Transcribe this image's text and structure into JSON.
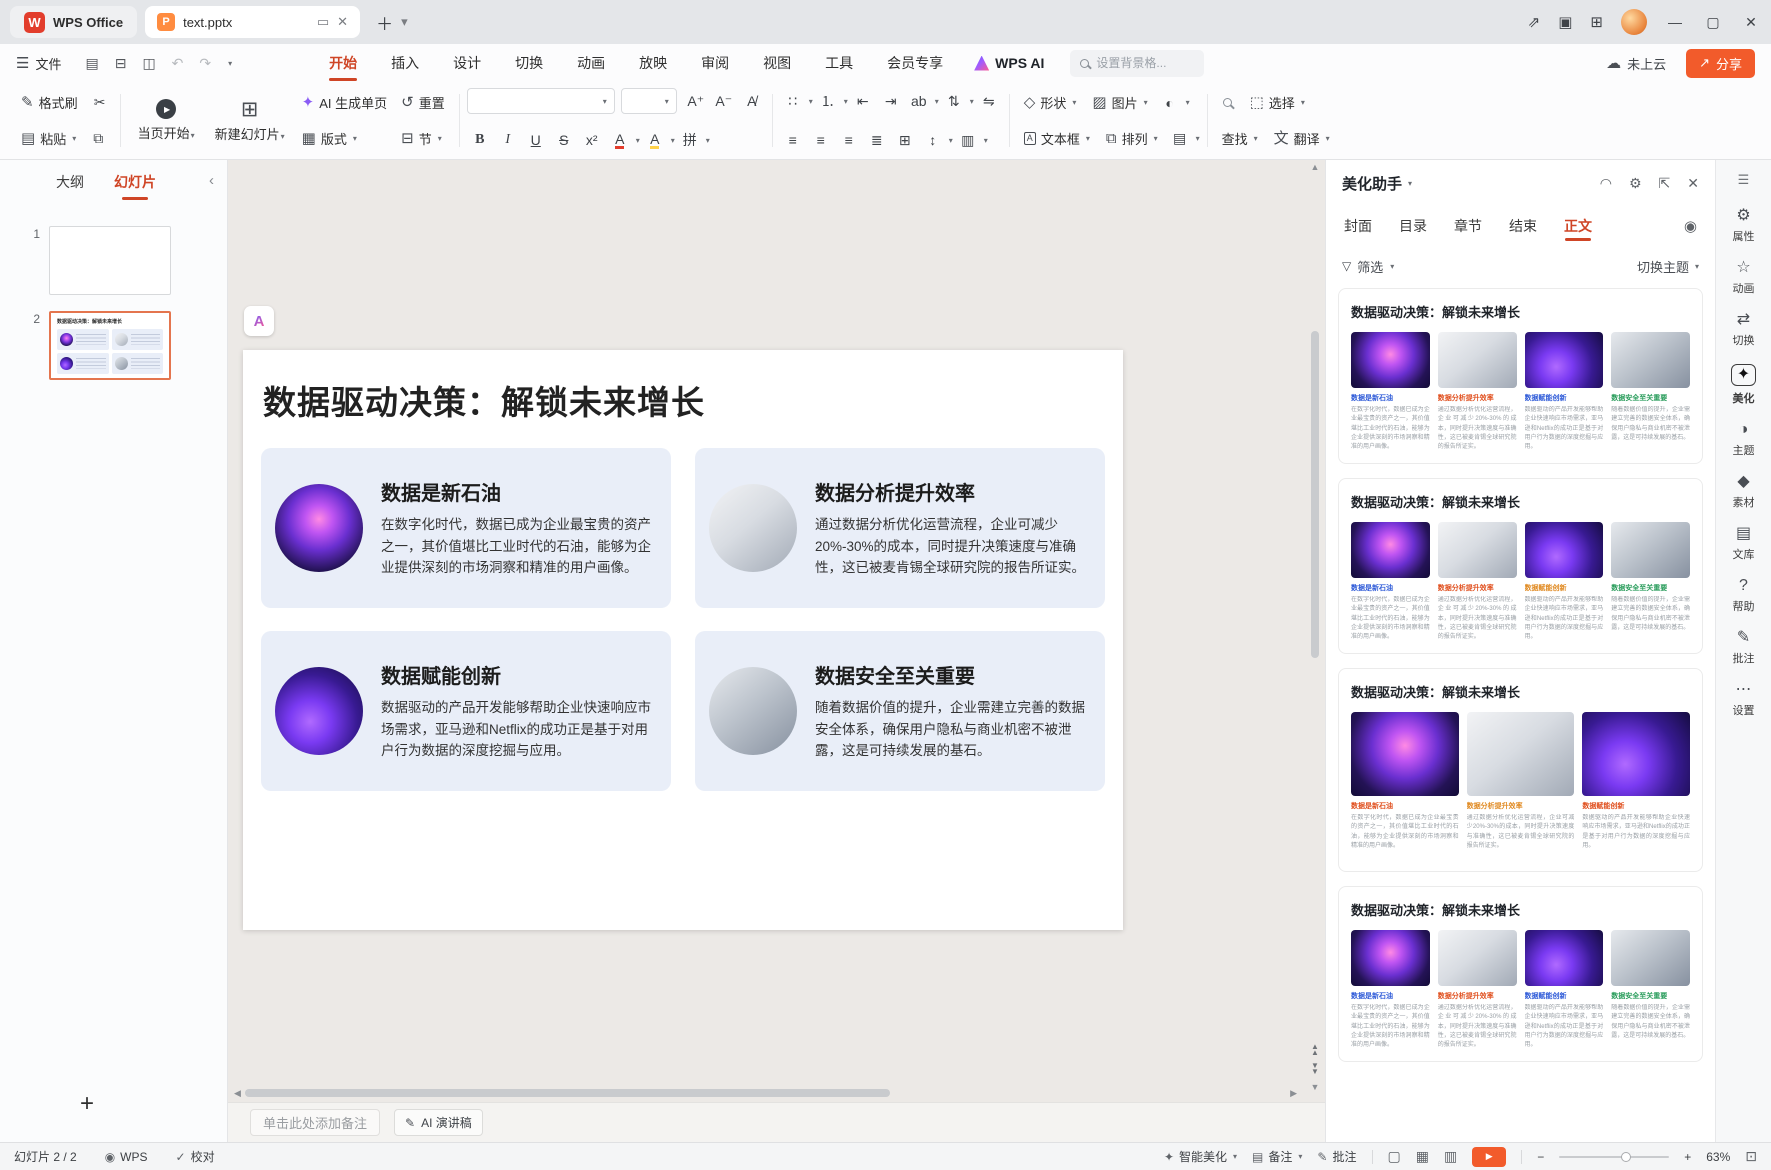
{
  "titlebar": {
    "home_tab": "WPS Office",
    "doc_tab": "text.pptx"
  },
  "menubar": {
    "file": "文件",
    "tabs": [
      "开始",
      "插入",
      "设计",
      "切换",
      "动画",
      "放映",
      "审阅",
      "视图",
      "工具",
      "会员专享"
    ],
    "active_tab": "开始",
    "wps_ai": "WPS AI",
    "search_placeholder": "设置背景格...",
    "cloud_status": "未上云",
    "share": "分享"
  },
  "toolbar": {
    "format_painter": "格式刷",
    "paste": "粘贴",
    "play_from_page": "当页开始",
    "new_slide": "新建幻灯片",
    "ai_generate_page": "AI 生成单页",
    "layout": "版式",
    "reset": "重置",
    "section": "节",
    "shape": "形状",
    "picture": "图片",
    "textbox": "文本框",
    "arrange": "排列",
    "find": "查找",
    "select": "选择",
    "translate": "翻译"
  },
  "left_panel": {
    "tabs": [
      "大纲",
      "幻灯片"
    ],
    "active_tab": "幻灯片",
    "slides": [
      "1",
      "2"
    ],
    "selected_slide": "2"
  },
  "slide": {
    "title": "数据驱动决策：解锁未来增长",
    "cards": [
      {
        "title": "数据是新石油",
        "body": "在数字化时代，数据已成为企业最宝贵的资产之一，其价值堪比工业时代的石油，能够为企业提供深刻的市场洞察和精准的用户画像。",
        "image": "oil"
      },
      {
        "title": "数据分析提升效率",
        "body": "通过数据分析优化运营流程，企业可减少20%-30%的成本，同时提升决策速度与准确性，这已被麦肯锡全球研究院的报告所证实。",
        "image": "desk"
      },
      {
        "title": "数据赋能创新",
        "body": "数据驱动的产品开发能够帮助企业快速响应市场需求，亚马逊和Netflix的成功正是基于对用户行为数据的深度挖掘与应用。",
        "image": "chart"
      },
      {
        "title": "数据安全至关重要",
        "body": "随着数据价值的提升，企业需建立完善的数据安全体系，确保用户隐私与商业机密不被泄露，这是可持续发展的基石。",
        "image": "security"
      }
    ]
  },
  "notes_bar": {
    "placeholder": "单击此处添加备注",
    "ai_speech": "AI 演讲稿"
  },
  "beautify": {
    "title": "美化助手",
    "tabs": [
      "封面",
      "目录",
      "章节",
      "结束",
      "正文"
    ],
    "active_tab": "正文",
    "filter": "筛选",
    "switch_theme": "切换主题",
    "themes": [
      {
        "title": "数据驱动决策：解锁未来增长",
        "cols": 4,
        "title_colors": [
          "#2f5bd8",
          "#e0501f",
          "#2f5bd8",
          "#2a9d5c"
        ]
      },
      {
        "title": "数据驱动决策：解锁未来增长",
        "cols": 4,
        "title_colors": [
          "#2f5bd8",
          "#e0501f",
          "#e08a22",
          "#2a9d5c"
        ]
      },
      {
        "title": "数据驱动决策：解锁未来增长",
        "cols": 3,
        "title_colors": [
          "#e0501f",
          "#e08a22",
          "#e0501f"
        ]
      },
      {
        "title": "数据驱动决策：解锁未来增长",
        "cols": 4,
        "title_colors": [
          "#2f5bd8",
          "#e0501f",
          "#2f5bd8",
          "#2a9d5c"
        ]
      }
    ]
  },
  "right_sidebar": {
    "active": "美化",
    "items": [
      {
        "label": "属性",
        "icon": "properties"
      },
      {
        "label": "动画",
        "icon": "animation"
      },
      {
        "label": "切换",
        "icon": "transition"
      },
      {
        "label": "美化",
        "icon": "beautify"
      },
      {
        "label": "主题",
        "icon": "theme"
      },
      {
        "label": "素材",
        "icon": "assets"
      },
      {
        "label": "文库",
        "icon": "library"
      },
      {
        "label": "帮助",
        "icon": "help"
      },
      {
        "label": "批注",
        "icon": "comment"
      },
      {
        "label": "设置",
        "icon": "settings"
      }
    ]
  },
  "statusbar": {
    "slide_info": "幻灯片 2 / 2",
    "wps": "WPS",
    "proofread": "校对",
    "smart_beautify": "智能美化",
    "notes": "备注",
    "comments": "批注",
    "zoom": "63%"
  }
}
